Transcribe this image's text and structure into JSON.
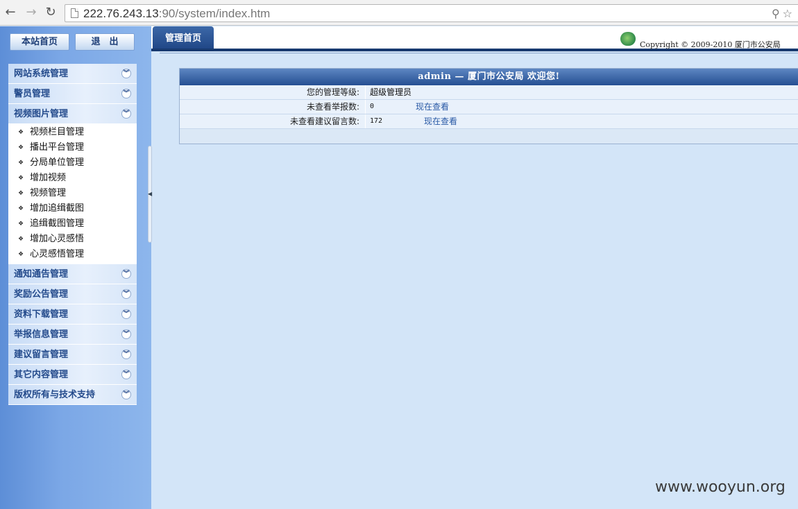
{
  "browser": {
    "back": "←",
    "forward": "→",
    "reload": "↻",
    "url_host": "222.76.243.13",
    "url_rest": ":90/system/index.htm"
  },
  "sidebar": {
    "home_button": "本站首页",
    "logout_button": "退　出",
    "menu_before": [
      {
        "label": "网站系统管理"
      },
      {
        "label": "警员管理"
      },
      {
        "label": "视频图片管理"
      }
    ],
    "submenu": [
      {
        "label": "视频栏目管理"
      },
      {
        "label": "播出平台管理"
      },
      {
        "label": "分局单位管理"
      },
      {
        "label": "增加视频"
      },
      {
        "label": "视频管理"
      },
      {
        "label": "增加追缉截图"
      },
      {
        "label": "追缉截图管理"
      },
      {
        "label": "增加心灵感悟"
      },
      {
        "label": "心灵感悟管理"
      }
    ],
    "menu_after": [
      {
        "label": "通知通告管理"
      },
      {
        "label": "奖励公告管理"
      },
      {
        "label": "资料下载管理"
      },
      {
        "label": "举报信息管理"
      },
      {
        "label": "建议留言管理"
      },
      {
        "label": "其它内容管理"
      },
      {
        "label": "版权所有与技术支持"
      }
    ]
  },
  "header": {
    "tab": "管理首页",
    "copyright": "Copyright ©  2009-2010  厦门市公安局"
  },
  "panel": {
    "title": "admin  —  厦门市公安局  欢迎您!",
    "rows": [
      {
        "label": "您的管理等级:",
        "value": "超级管理员",
        "link": ""
      },
      {
        "label": "未查看举报数:",
        "value": "0",
        "link": "现在查看"
      },
      {
        "label": "未查看建议留言数:",
        "value": "172",
        "link": "现在查看"
      }
    ]
  },
  "watermark": "www.wooyun.org",
  "colors": {
    "sidebar": "#7ba7e6",
    "tab": "#1f4585",
    "panel_title": "#254f92",
    "content_bg": "#d3e5f8",
    "link": "#2a5aa6"
  }
}
